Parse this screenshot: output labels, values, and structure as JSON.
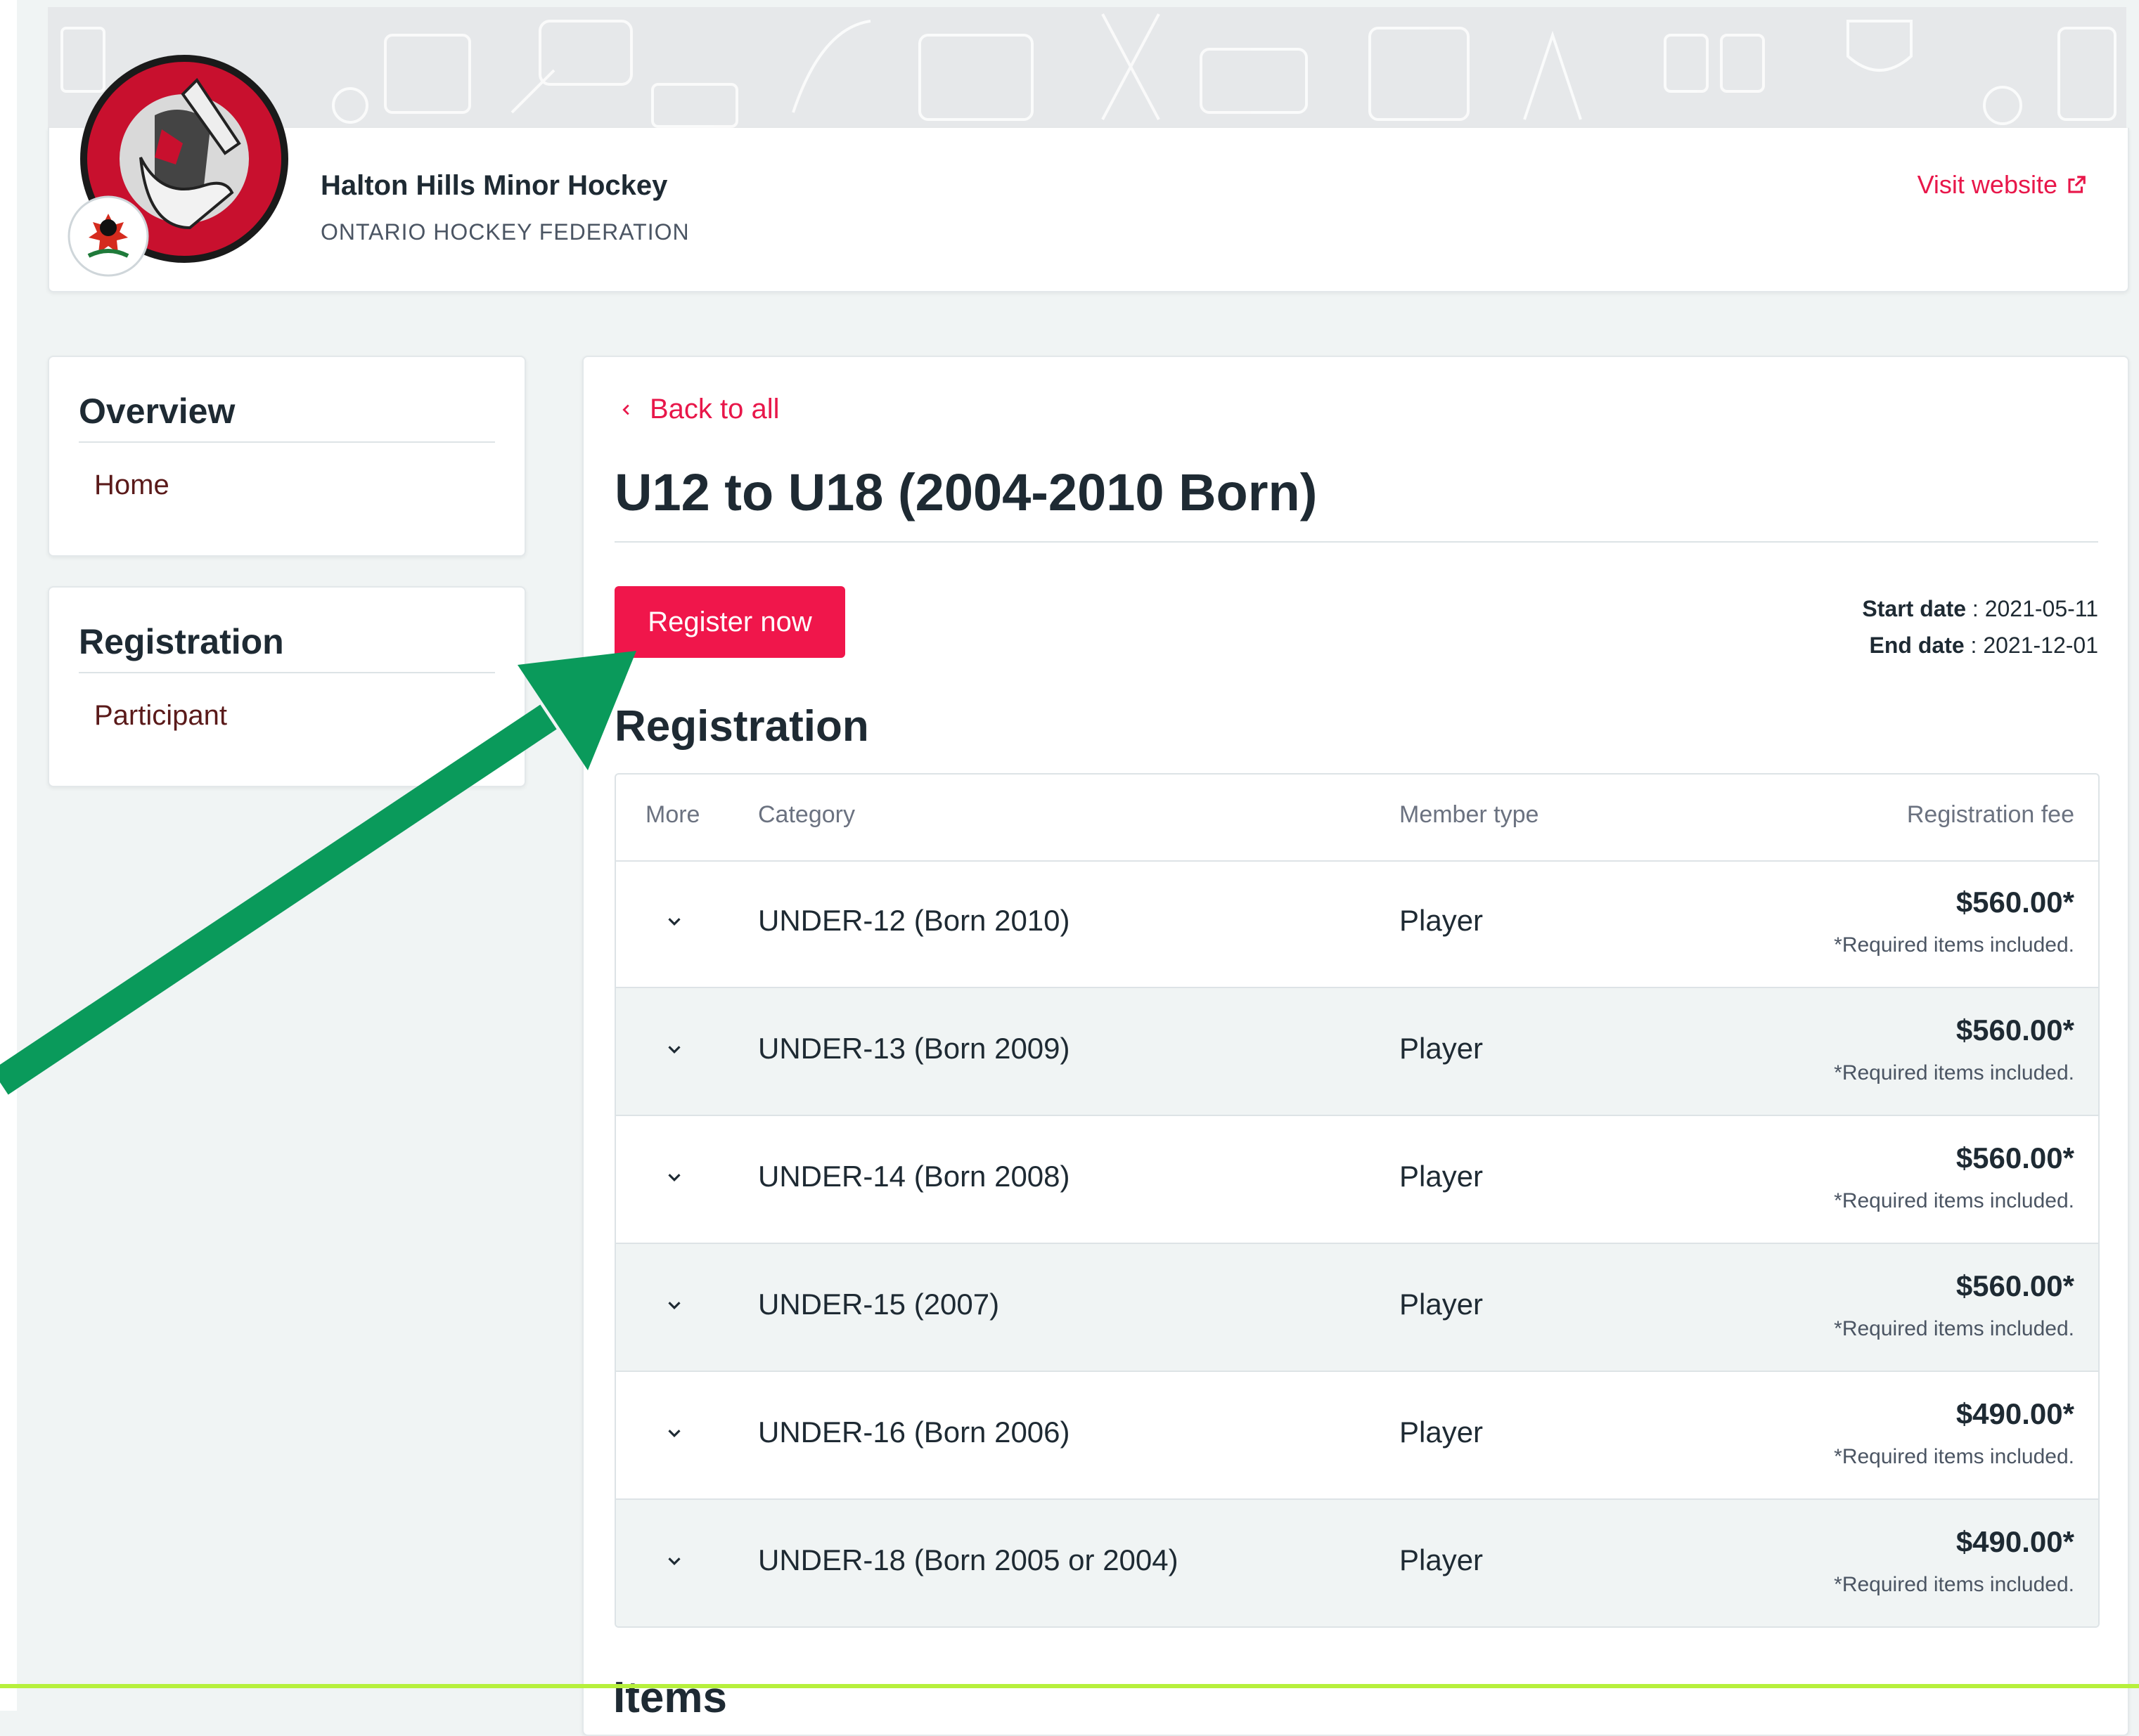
{
  "org": {
    "name": "Halton Hills Minor Hockey",
    "federation": "ONTARIO HOCKEY FEDERATION",
    "visit_label": "Visit website"
  },
  "sidebar": {
    "overview": {
      "title": "Overview",
      "items": [
        {
          "label": "Home"
        }
      ]
    },
    "registration": {
      "title": "Registration",
      "items": [
        {
          "label": "Participant"
        }
      ]
    }
  },
  "main": {
    "back_label": "Back to all",
    "title": "U12 to U18 (2004-2010 Born)",
    "register_label": "Register now",
    "start_label": "Start date",
    "start_value": ": 2021-05-11",
    "end_label": "End date",
    "end_value": ": 2021-12-01",
    "section_title": "Registration",
    "items_title": "Items"
  },
  "table": {
    "headers": {
      "more": "More",
      "category": "Category",
      "member_type": "Member type",
      "fee": "Registration fee"
    },
    "rows": [
      {
        "category": "UNDER-12 (Born 2010)",
        "member_type": "Player",
        "fee": "$560.00*",
        "note": "*Required items included."
      },
      {
        "category": "UNDER-13 (Born 2009)",
        "member_type": "Player",
        "fee": "$560.00*",
        "note": "*Required items included."
      },
      {
        "category": "UNDER-14 (Born 2008)",
        "member_type": "Player",
        "fee": "$560.00*",
        "note": "*Required items included."
      },
      {
        "category": "UNDER-15 (2007)",
        "member_type": "Player",
        "fee": "$560.00*",
        "note": "*Required items included."
      },
      {
        "category": "UNDER-16 (Born 2006)",
        "member_type": "Player",
        "fee": "$490.00*",
        "note": "*Required items included."
      },
      {
        "category": "UNDER-18 (Born 2005 or 2004)",
        "member_type": "Player",
        "fee": "$490.00*",
        "note": "*Required items included."
      }
    ]
  },
  "colors": {
    "accent": "#f0164b",
    "arrow": "#0a9a5b",
    "highlight_line": "#b6f03c"
  },
  "icons": {
    "back": "chevron-left-icon",
    "external": "external-link-icon",
    "expand": "chevron-down-icon"
  }
}
